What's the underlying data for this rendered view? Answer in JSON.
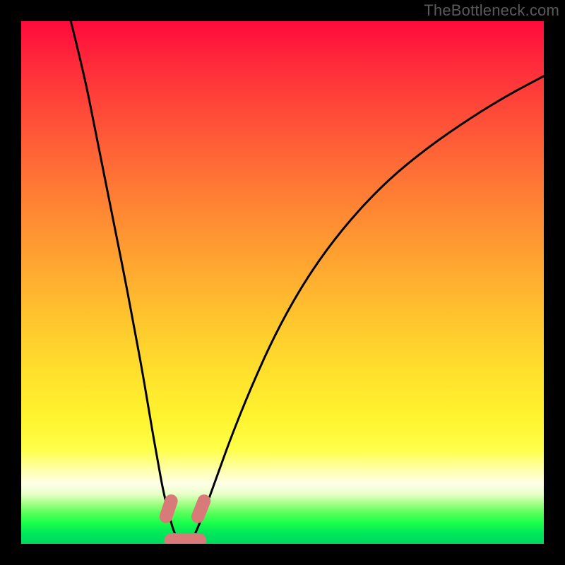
{
  "watermark": {
    "text": "TheBottleneck.com"
  },
  "colors": {
    "curve_stroke": "#000000",
    "blob_fill": "#d87a78",
    "blob_stroke": "#c96a68",
    "frame": "#000000"
  },
  "chart_data": {
    "type": "line",
    "title": "",
    "xlabel": "",
    "ylabel": "",
    "xlim": [
      0,
      100
    ],
    "ylim": [
      0,
      100
    ],
    "series": [
      {
        "name": "left-curve",
        "x": [
          9.5,
          12,
          14,
          16,
          18,
          20,
          21.5,
          23,
          24.2,
          25.2,
          26.2,
          27,
          27.8,
          28.5,
          29,
          29.4
        ],
        "y": [
          100,
          90,
          80,
          70,
          60,
          50,
          42,
          34,
          27,
          21,
          15.5,
          11,
          7.5,
          4.8,
          3,
          2
        ]
      },
      {
        "name": "right-curve",
        "x": [
          33.3,
          34.2,
          35.5,
          37.5,
          40,
          44,
          49,
          55,
          62,
          70,
          78,
          86,
          93,
          100
        ],
        "y": [
          2,
          4,
          7.5,
          13,
          20,
          30,
          41,
          51.5,
          61,
          69.5,
          76,
          81.5,
          85.8,
          89.5
        ]
      }
    ],
    "annotations": [
      {
        "name": "bottom-blob",
        "shape": "sausage",
        "x1": 28.8,
        "y1": 0.6,
        "x2": 34.0,
        "y2": 0.6,
        "r": 1.45
      },
      {
        "name": "left-blob",
        "shape": "sausage",
        "x1": 27.7,
        "y1": 5.2,
        "x2": 28.7,
        "y2": 8.2,
        "r": 1.25
      },
      {
        "name": "right-blob",
        "shape": "sausage",
        "x1": 33.8,
        "y1": 5.2,
        "x2": 35.0,
        "y2": 8.2,
        "r": 1.25
      }
    ],
    "background_gradient": {
      "direction": "vertical",
      "stops": [
        {
          "pos": 0.0,
          "color": "#ff0a3c"
        },
        {
          "pos": 0.46,
          "color": "#ffa430"
        },
        {
          "pos": 0.82,
          "color": "#ffff4a"
        },
        {
          "pos": 0.9,
          "color": "#ffffe0"
        },
        {
          "pos": 1.0,
          "color": "#00d860"
        }
      ]
    }
  }
}
